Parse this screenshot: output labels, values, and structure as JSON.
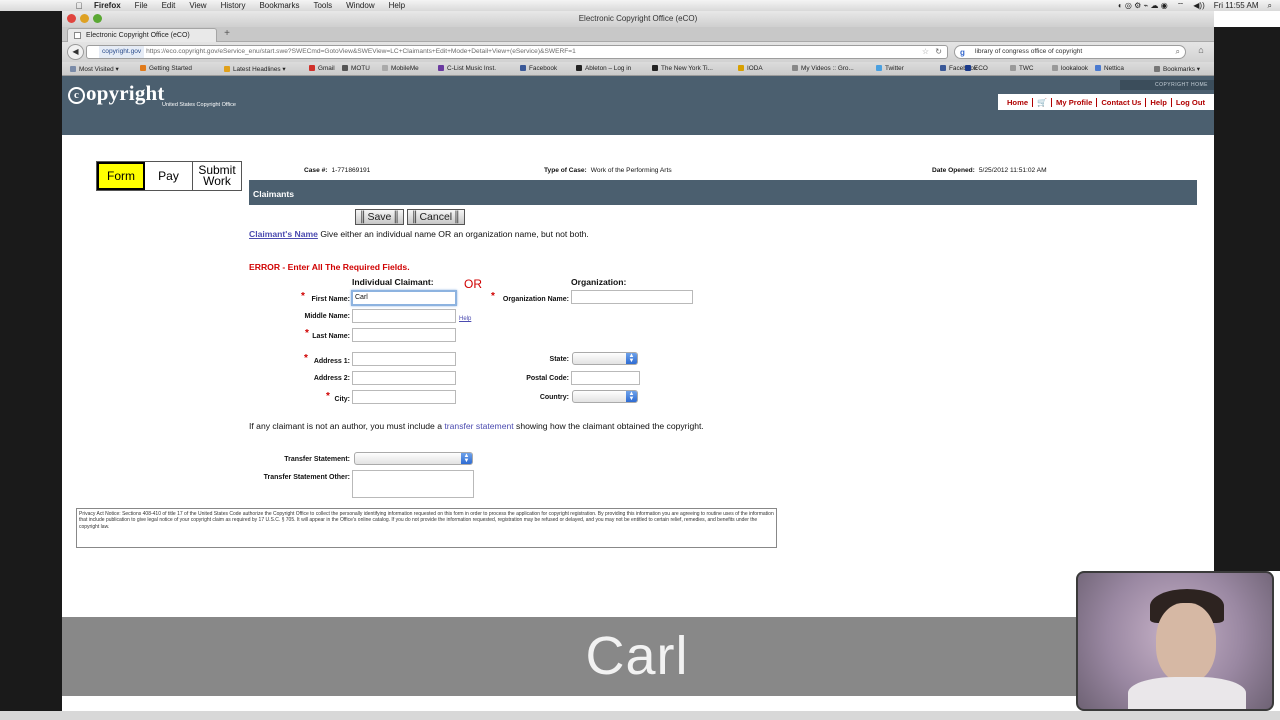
{
  "os_menubar": {
    "app": "Firefox",
    "items": [
      "File",
      "Edit",
      "View",
      "History",
      "Bookmarks",
      "Tools",
      "Window",
      "Help"
    ],
    "clock": "Fri 11:55 AM"
  },
  "window": {
    "title": "Electronic Copyright Office (eCO)",
    "tab_title": "Electronic Copyright Office (eCO)",
    "new_tab": "+"
  },
  "navbar": {
    "url_domain": "copyright.gov",
    "url_path": "https://eco.copyright.gov/eService_enu/start.swe?SWECmd=GotoView&SWEView=LC+Claimants+Edit+Mode+Detail+View+(eService)&SWERF=1",
    "search_text": "library of congress office of copyright"
  },
  "bookmarks": [
    {
      "label": "Most Visited ▾",
      "color": "#7a8ba8"
    },
    {
      "label": "Getting Started",
      "color": "#e07a1a"
    },
    {
      "label": "Latest Headlines ▾",
      "color": "#e0a01a"
    },
    {
      "label": "Gmail",
      "color": "#d0302a"
    },
    {
      "label": "MOTU",
      "color": "#555555"
    },
    {
      "label": "MobileMe",
      "color": "#aaaaaa"
    },
    {
      "label": "C-List Music Inst.",
      "color": "#6a3aa0"
    },
    {
      "label": "Facebook",
      "color": "#3b5998"
    },
    {
      "label": "Ableton – Log in",
      "color": "#222222"
    },
    {
      "label": "The New York Ti...",
      "color": "#222222"
    },
    {
      "label": "IODA",
      "color": "#d8a000"
    },
    {
      "label": "My Videos :: Gro...",
      "color": "#888888"
    },
    {
      "label": "Twitter",
      "color": "#4aa0e0"
    },
    {
      "label": "Facebook",
      "color": "#3b5998"
    },
    {
      "label": "ECO",
      "color": "#1a3a8a"
    },
    {
      "label": "TWC",
      "color": "#999999"
    },
    {
      "label": "lookalook",
      "color": "#999999"
    },
    {
      "label": "Nettica",
      "color": "#4a7ad0"
    },
    {
      "label": "Bookmarks ▾",
      "color": "#777777"
    }
  ],
  "site": {
    "logo": "opyright",
    "logo_c": "c",
    "logo_sub": "United States Copyright Office",
    "home_badge": "COPYRIGHT HOME",
    "links": {
      "home": "Home",
      "my_profile": "My Profile",
      "contact": "Contact Us",
      "help": "Help",
      "logout": "Log Out"
    }
  },
  "steps": [
    {
      "label": "Form",
      "active": true
    },
    {
      "label": "Pay",
      "active": false
    },
    {
      "label": "Submit Work",
      "active": false
    }
  ],
  "case": {
    "case_label": "Case #:",
    "case_value": "1-771869191",
    "type_label": "Type of Case:",
    "type_value": "Work of the Performing Arts",
    "date_label": "Date Opened:",
    "date_value": "5/25/2012 11:51:02 AM"
  },
  "section_title": "Claimants",
  "buttons": {
    "save": "Save",
    "cancel": "Cancel"
  },
  "intro": {
    "link": "Claimant's Name",
    "text": "Give either an individual name OR an organization name, but not both."
  },
  "error": "ERROR - Enter All The Required Fields.",
  "form": {
    "individual_heading": "Individual Claimant:",
    "or_text": "OR",
    "org_heading": "Organization:",
    "first_name_label": "First Name:",
    "first_name_value": "Carl",
    "middle_name_label": "Middle Name:",
    "last_name_label": "Last Name:",
    "help_link": "Help",
    "org_name_label": "Organization Name:",
    "address1_label": "Address 1:",
    "address2_label": "Address 2:",
    "city_label": "City:",
    "state_label": "State:",
    "postal_label": "Postal Code:",
    "country_label": "Country:",
    "transfer_note_pre": "If any claimant is not an author, you must include a ",
    "transfer_note_link": "transfer statement",
    "transfer_note_post": " showing how the claimant obtained the copyright.",
    "transfer_label": "Transfer Statement:",
    "transfer_other_label": "Transfer Statement Other:"
  },
  "privacy": "Privacy Act Notice: Sections 408-410 of title 17 of the United States Code authorize the Copyright Office to collect the personally identifying information requested on this form in order to process the application for copyright registration. By providing this information you are agreeing to routine uses of the information that include publication to give legal notice of your copyright claim as required by 17 U.S.C. § 705. It will appear in the Office's online catalog. If you do not provide the information requested, registration may be refused or delayed, and you may not be entitled to certain relief, remedies, and benefits under the copyright law.",
  "caption": "Carl",
  "colors": {
    "header": "#4b5f6f",
    "link_red": "#b00000",
    "error_red": "#d00000",
    "active_step": "#ffff00"
  }
}
